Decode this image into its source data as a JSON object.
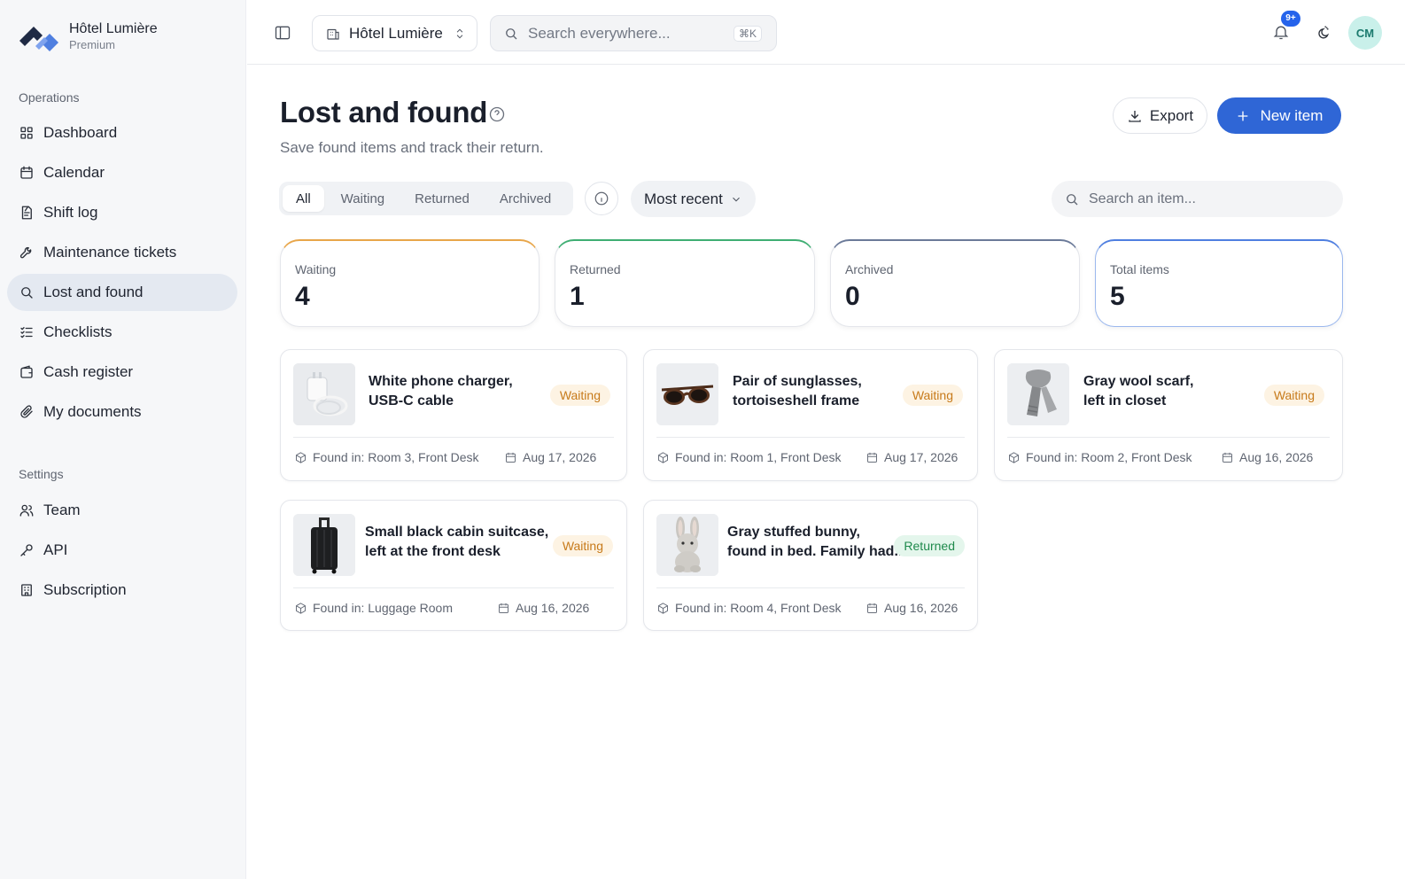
{
  "brand": {
    "name": "Hôtel Lumière",
    "plan": "Premium"
  },
  "sidebar": {
    "operations_label": "Operations",
    "settings_label": "Settings",
    "items": [
      {
        "label": "Dashboard",
        "icon": "dashboard-icon"
      },
      {
        "label": "Calendar",
        "icon": "calendar-icon"
      },
      {
        "label": "Shift log",
        "icon": "shift-log-icon"
      },
      {
        "label": "Maintenance tickets",
        "icon": "wrench-icon"
      },
      {
        "label": "Lost and found",
        "icon": "search-icon",
        "active": true
      },
      {
        "label": "Checklists",
        "icon": "checklist-icon"
      },
      {
        "label": "Cash register",
        "icon": "wallet-icon"
      },
      {
        "label": "My documents",
        "icon": "paperclip-icon"
      }
    ],
    "settings_items": [
      {
        "label": "Team",
        "icon": "team-icon"
      },
      {
        "label": "API",
        "icon": "key-icon"
      },
      {
        "label": "Subscription",
        "icon": "building-icon"
      }
    ]
  },
  "topbar": {
    "hotel_select": "Hôtel Lumière",
    "search_placeholder": "Search everywhere...",
    "search_shortcut": "⌘K",
    "notifications_badge": "9+",
    "avatar_initials": "CM"
  },
  "page": {
    "title": "Lost and found",
    "subtitle": "Save found items and track their return.",
    "export_label": "Export",
    "new_item_label": "New item",
    "tabs": [
      "All",
      "Waiting",
      "Returned",
      "Archived"
    ],
    "active_tab": "All",
    "sort_value": "Most recent",
    "item_search_placeholder": "Search an item..."
  },
  "stats": [
    {
      "label": "Waiting",
      "value": "4",
      "accent": "#e8a64a"
    },
    {
      "label": "Returned",
      "value": "1",
      "accent": "#3fae73"
    },
    {
      "label": "Archived",
      "value": "0",
      "accent": "#6b7a99"
    },
    {
      "label": "Total items",
      "value": "5",
      "accent": "#4f7fe0"
    }
  ],
  "items": [
    {
      "title": "White phone charger,\nUSB-C cable",
      "status": "Waiting",
      "location": "Found in: Room 3, Front Desk",
      "date": "Aug 17, 2026",
      "thumb": "charger-image"
    },
    {
      "title": "Pair of sunglasses,\ntortoiseshell frame",
      "status": "Waiting",
      "location": "Found in: Room 1, Front Desk",
      "date": "Aug 17, 2026",
      "thumb": "sunglasses-image"
    },
    {
      "title": "Gray wool scarf,\nleft in closet",
      "status": "Waiting",
      "location": "Found in: Room 2, Front Desk",
      "date": "Aug 16, 2026",
      "thumb": "scarf-image"
    },
    {
      "title": "Small black cabin suitcase,\nleft at the front desk",
      "status": "Waiting",
      "location": "Found in: Luggage Room",
      "date": "Aug 16, 2026",
      "thumb": "suitcase-image"
    },
    {
      "title": "Gray stuffed bunny,\nfound in bed. Family had...",
      "status": "Returned",
      "location": "Found in: Room 4, Front Desk",
      "date": "Aug 16, 2026",
      "thumb": "bunny-image"
    }
  ]
}
